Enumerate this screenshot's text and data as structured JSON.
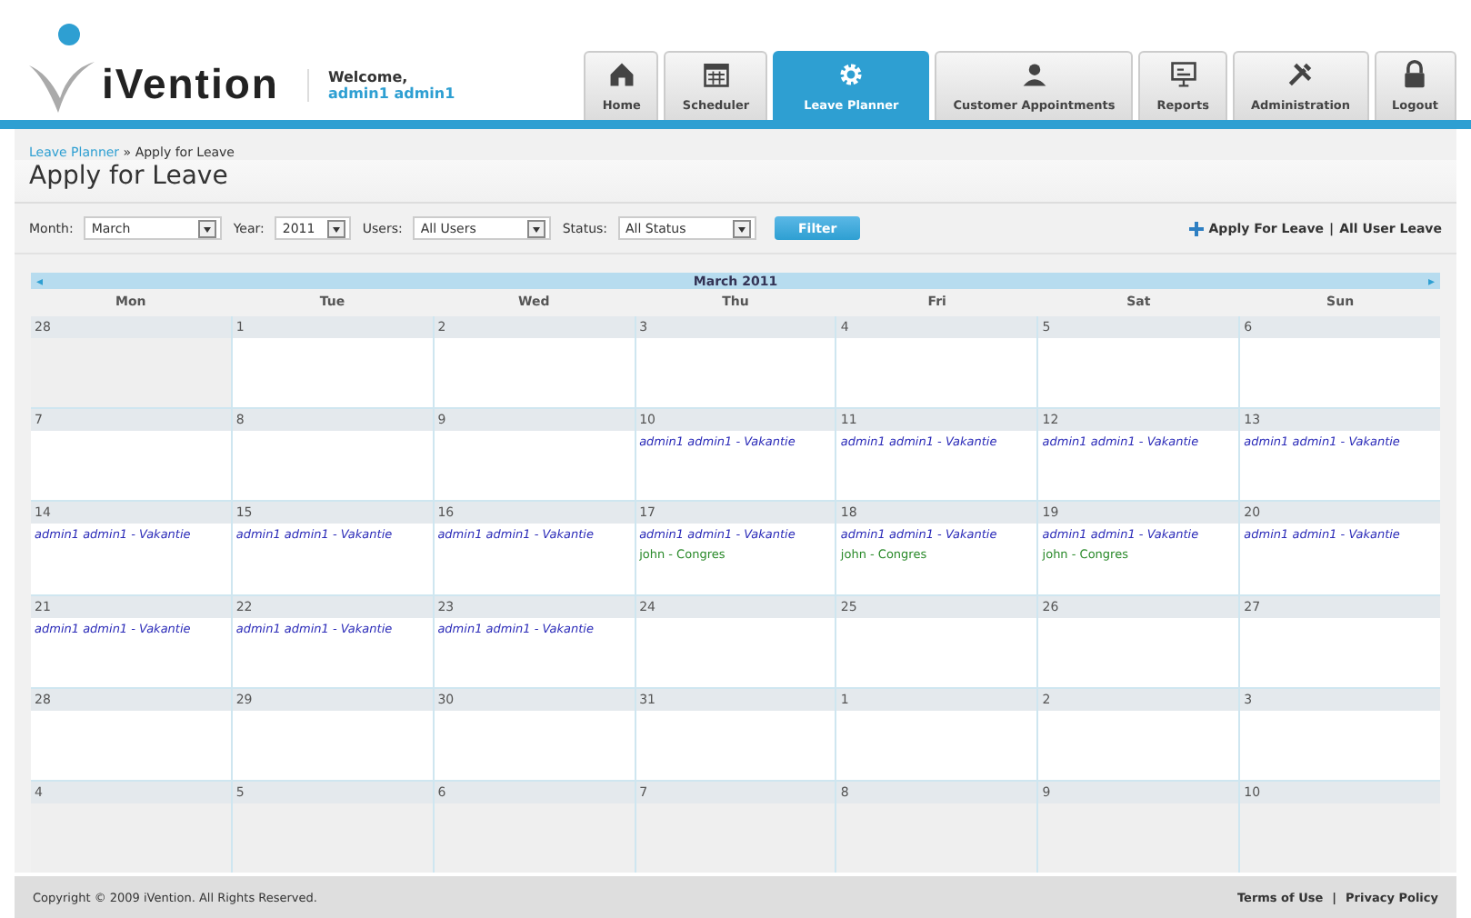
{
  "logo": {
    "text": "iVention"
  },
  "welcome": {
    "label": "Welcome,",
    "user": "admin1 admin1"
  },
  "nav": [
    {
      "label": "Home",
      "selected": false
    },
    {
      "label": "Scheduler",
      "selected": false
    },
    {
      "label": "Leave Planner",
      "selected": true
    },
    {
      "label": "Customer Appointments",
      "selected": false
    },
    {
      "label": "Reports",
      "selected": false
    },
    {
      "label": "Administration",
      "selected": false
    },
    {
      "label": "Logout",
      "selected": false
    }
  ],
  "breadcrumb": {
    "link": "Leave Planner",
    "separator": "»",
    "current": "Apply for Leave"
  },
  "page_title": "Apply for Leave",
  "filters": [
    {
      "label": "Month:",
      "value": "March"
    },
    {
      "label": "Year:",
      "value": "2011"
    },
    {
      "label": "Users:",
      "value": "All Users"
    },
    {
      "label": "Status:",
      "value": "All Status"
    }
  ],
  "filter_button": "Filter",
  "actions": {
    "apply": "Apply For Leave",
    "separator": "|",
    "all": "All User Leave"
  },
  "calendar": {
    "title": "March 2011",
    "prev": "◂",
    "next": "▸",
    "weekdays": [
      "Mon",
      "Tue",
      "Wed",
      "Thu",
      "Fri",
      "Sat",
      "Sun"
    ],
    "weeks": [
      [
        {
          "day": "28",
          "shaded": true
        },
        {
          "day": "1",
          "shaded": false
        },
        {
          "day": "2",
          "shaded": false
        },
        {
          "day": "3",
          "shaded": false
        },
        {
          "day": "4",
          "shaded": false
        },
        {
          "day": "5",
          "shaded": false
        },
        {
          "day": "6",
          "shaded": false
        }
      ],
      [
        {
          "day": "7",
          "shaded": false
        },
        {
          "day": "8",
          "shaded": false
        },
        {
          "day": "9",
          "shaded": false
        },
        {
          "day": "10",
          "shaded": false,
          "events": [
            {
              "text": "admin1 admin1 - Vakantie",
              "kind": "vacation"
            }
          ]
        },
        {
          "day": "11",
          "shaded": false,
          "events": [
            {
              "text": "admin1 admin1 - Vakantie",
              "kind": "vacation"
            }
          ]
        },
        {
          "day": "12",
          "shaded": false,
          "events": [
            {
              "text": "admin1 admin1 - Vakantie",
              "kind": "vacation"
            }
          ]
        },
        {
          "day": "13",
          "shaded": false,
          "events": [
            {
              "text": "admin1 admin1 - Vakantie",
              "kind": "vacation"
            }
          ]
        }
      ],
      [
        {
          "day": "14",
          "shaded": false,
          "events": [
            {
              "text": "admin1 admin1 - Vakantie",
              "kind": "vacation"
            }
          ]
        },
        {
          "day": "15",
          "shaded": false,
          "events": [
            {
              "text": "admin1 admin1 - Vakantie",
              "kind": "vacation"
            }
          ]
        },
        {
          "day": "16",
          "shaded": false,
          "events": [
            {
              "text": "admin1 admin1 - Vakantie",
              "kind": "vacation"
            }
          ]
        },
        {
          "day": "17",
          "shaded": false,
          "events": [
            {
              "text": "admin1 admin1 - Vakantie",
              "kind": "vacation"
            },
            {
              "text": "john - Congres",
              "kind": "congress"
            }
          ]
        },
        {
          "day": "18",
          "shaded": false,
          "events": [
            {
              "text": "admin1 admin1 - Vakantie",
              "kind": "vacation"
            },
            {
              "text": "john - Congres",
              "kind": "congress"
            }
          ]
        },
        {
          "day": "19",
          "shaded": false,
          "events": [
            {
              "text": "admin1 admin1 - Vakantie",
              "kind": "vacation"
            },
            {
              "text": "john - Congres",
              "kind": "congress"
            }
          ]
        },
        {
          "day": "20",
          "shaded": false,
          "events": [
            {
              "text": "admin1 admin1 - Vakantie",
              "kind": "vacation"
            }
          ]
        }
      ],
      [
        {
          "day": "21",
          "shaded": false,
          "events": [
            {
              "text": "admin1 admin1 - Vakantie",
              "kind": "vacation"
            }
          ]
        },
        {
          "day": "22",
          "shaded": false,
          "events": [
            {
              "text": "admin1 admin1 - Vakantie",
              "kind": "vacation"
            }
          ]
        },
        {
          "day": "23",
          "shaded": false,
          "events": [
            {
              "text": "admin1 admin1 - Vakantie",
              "kind": "vacation"
            }
          ]
        },
        {
          "day": "24",
          "shaded": false
        },
        {
          "day": "25",
          "shaded": false
        },
        {
          "day": "26",
          "shaded": false
        },
        {
          "day": "27",
          "shaded": false
        }
      ],
      [
        {
          "day": "28",
          "shaded": false
        },
        {
          "day": "29",
          "shaded": false
        },
        {
          "day": "30",
          "shaded": false
        },
        {
          "day": "31",
          "shaded": false
        },
        {
          "day": "1",
          "shaded": false
        },
        {
          "day": "2",
          "shaded": false
        },
        {
          "day": "3",
          "shaded": false
        }
      ],
      [
        {
          "day": "4",
          "shaded": true
        },
        {
          "day": "5",
          "shaded": true
        },
        {
          "day": "6",
          "shaded": true
        },
        {
          "day": "7",
          "shaded": true
        },
        {
          "day": "8",
          "shaded": true
        },
        {
          "day": "9",
          "shaded": true
        },
        {
          "day": "10",
          "shaded": true
        }
      ]
    ]
  },
  "footer": {
    "copyright": "Copyright © 2009 iVention. All Rights Reserved.",
    "links": [
      "Terms of Use",
      "Privacy Policy"
    ],
    "separator": "|"
  }
}
